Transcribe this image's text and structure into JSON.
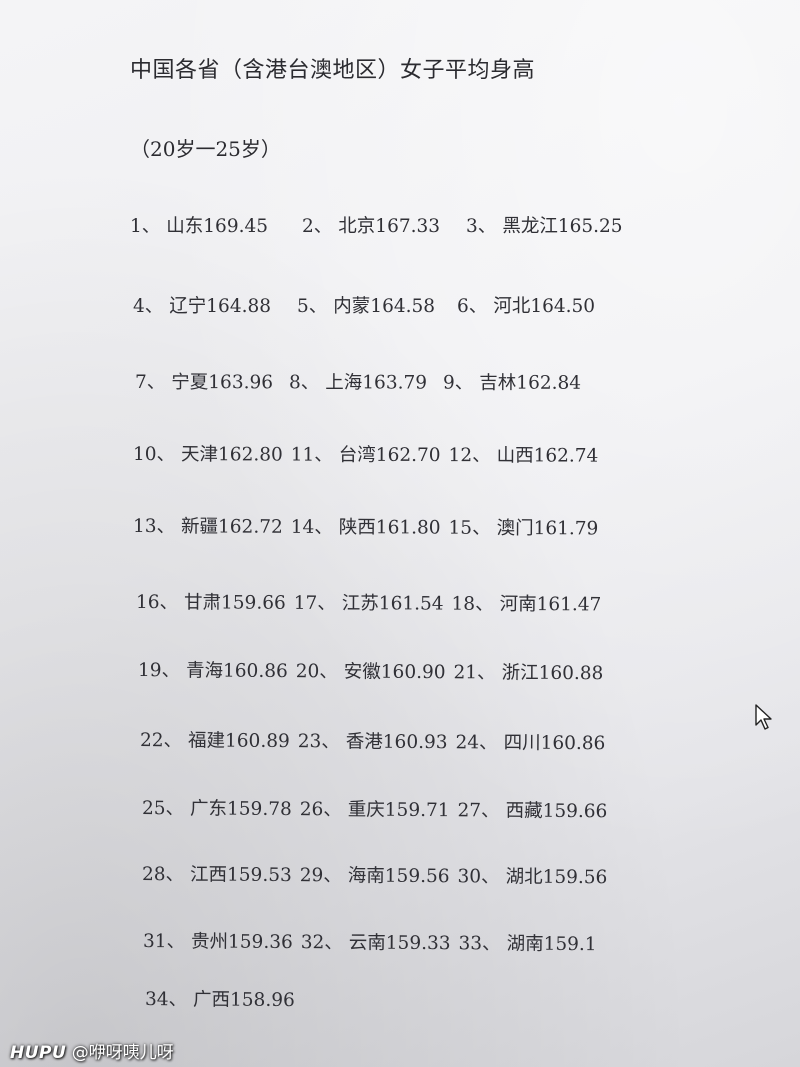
{
  "document": {
    "title": "中国各省（含港台澳地区）女子平均身高",
    "subtitle": "（20岁一25岁）",
    "rows": [
      [
        {
          "rank": "1、",
          "text": "山东169.45"
        },
        {
          "rank": "2、",
          "text": "北京167.33"
        },
        {
          "rank": "3、",
          "text": "黑龙江165.25"
        }
      ],
      [
        {
          "rank": "4、",
          "text": "辽宁164.88"
        },
        {
          "rank": "5、",
          "text": "内蒙164.58"
        },
        {
          "rank": "6、",
          "text": "河北164.50"
        }
      ],
      [
        {
          "rank": "7、",
          "text": "宁夏163.96"
        },
        {
          "rank": "8、",
          "text": "上海163.79"
        },
        {
          "rank": "9、",
          "text": "吉林162.84"
        }
      ],
      [
        {
          "rank": "10、",
          "text": "天津162.80"
        },
        {
          "rank": "11、",
          "text": "台湾162.70"
        },
        {
          "rank": "12、",
          "text": "山西162.74"
        }
      ],
      [
        {
          "rank": "13、",
          "text": "新疆162.72"
        },
        {
          "rank": "14、",
          "text": "陕西161.80"
        },
        {
          "rank": "15、",
          "text": "澳门161.79"
        }
      ],
      [
        {
          "rank": "16、",
          "text": "甘肃159.66"
        },
        {
          "rank": "17、",
          "text": "江苏161.54"
        },
        {
          "rank": "18、",
          "text": "河南161.47"
        }
      ],
      [
        {
          "rank": "19、",
          "text": "青海160.86"
        },
        {
          "rank": "20、",
          "text": "安徽160.90"
        },
        {
          "rank": "21、",
          "text": "浙江160.88"
        }
      ],
      [
        {
          "rank": "22、",
          "text": "福建160.89"
        },
        {
          "rank": "23、",
          "text": "香港160.93"
        },
        {
          "rank": "24、",
          "text": "四川160.86"
        }
      ],
      [
        {
          "rank": "25、",
          "text": "广东159.78"
        },
        {
          "rank": "26、",
          "text": "重庆159.71"
        },
        {
          "rank": "27、",
          "text": "西藏159.66"
        }
      ],
      [
        {
          "rank": "28、",
          "text": "江西159.53"
        },
        {
          "rank": "29、",
          "text": "海南159.56"
        },
        {
          "rank": "30、",
          "text": "湖北159.56"
        }
      ],
      [
        {
          "rank": "31、",
          "text": "贵州159.36"
        },
        {
          "rank": "32、",
          "text": "云南159.33"
        },
        {
          "rank": "33、",
          "text": "湖南159.1"
        }
      ],
      [
        {
          "rank": "34、",
          "text": "广西158.96"
        }
      ]
    ]
  },
  "watermark": {
    "brand": "HUPU",
    "user": "@咿呀咦儿呀"
  }
}
